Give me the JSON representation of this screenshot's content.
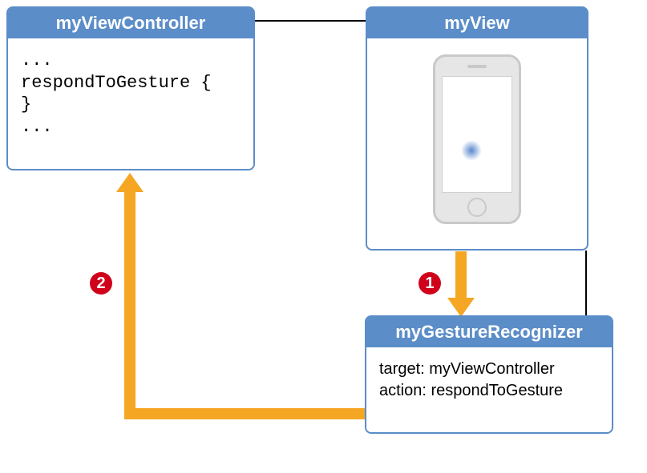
{
  "colors": {
    "header_bg": "#5b8dc8",
    "arrow": "#f5a623",
    "badge": "#d0021b"
  },
  "viewController": {
    "title": "myViewController",
    "code": "...\nrespondToGesture {\n}\n..."
  },
  "view": {
    "title": "myView"
  },
  "gestureRecognizer": {
    "title": "myGestureRecognizer",
    "target_label": "target:",
    "target_value": "myViewController",
    "action_label": "action:",
    "action_value": "respondToGesture"
  },
  "steps": {
    "one": "1",
    "two": "2"
  }
}
